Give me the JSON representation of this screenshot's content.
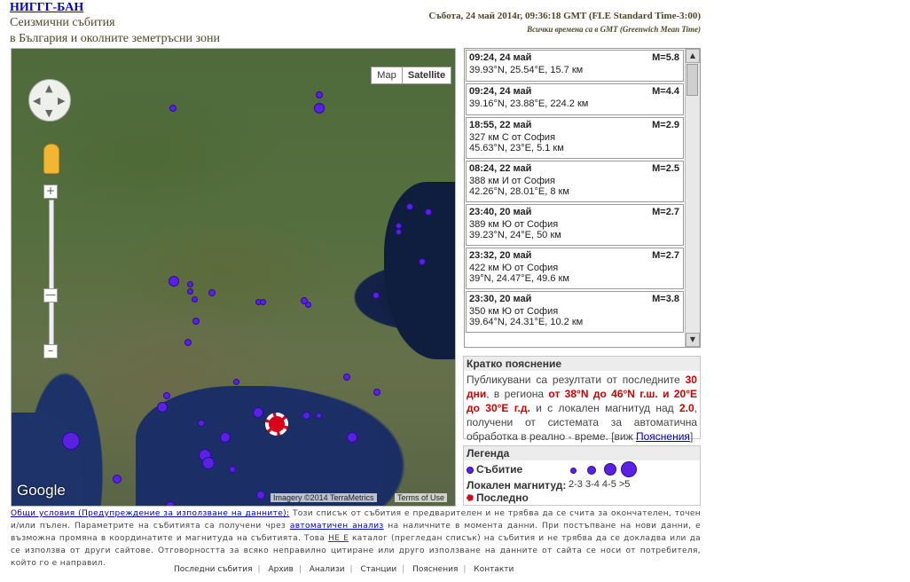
{
  "header": {
    "org_link": "НИГГГ-БАН",
    "subtitle_1": "Сеизмични събития",
    "subtitle_2": "в България и околните земетръсни зони",
    "datetime": "Събота, 24 май 2014г, 09:36:18 GMT (FLE Standard Time-3:00)",
    "gmt_note": "Всички времена са в GMT (Greenwich Mean Time)"
  },
  "map": {
    "map_button": "Map",
    "satellite_button": "Satellite",
    "zoom_in": "+",
    "zoom_out": "–",
    "google_logo": "Google",
    "imagery": "Imagery ©2014 TerraMetrics",
    "terms": "Terms of Use"
  },
  "events": [
    {
      "time": "09:24, 24 май",
      "mag": "M=5.8",
      "line1": "39.93°N, 25.54°E, 15.7 км",
      "line2": ""
    },
    {
      "time": "09:24, 24 май",
      "mag": "M=4.4",
      "line1": "39.16°N, 23.88°E, 224.2 км",
      "line2": ""
    },
    {
      "time": "18:55, 22 май",
      "mag": "M=2.9",
      "line1": "327 км С от София",
      "line2": "45.63°N, 23°E, 5.1 км"
    },
    {
      "time": "08:24, 22 май",
      "mag": "M=2.5",
      "line1": "388 км И от София",
      "line2": "42.26°N, 28.01°E, 8 км"
    },
    {
      "time": "23:40, 20 май",
      "mag": "M=2.7",
      "line1": "389 км Ю от София",
      "line2": "39.23°N, 24°E, 50 км"
    },
    {
      "time": "23:32, 20 май",
      "mag": "M=2.7",
      "line1": "422 км Ю от София",
      "line2": "39°N, 24.47°E, 49.6 км"
    },
    {
      "time": "23:30, 20 май",
      "mag": "M=3.8",
      "line1": "350 км Ю от София",
      "line2": "39.64°N, 24.31°E, 10.2 км"
    }
  ],
  "note": {
    "title": "Кратко пояснение",
    "p1": "Публикувани са резултати от последните",
    "p2": "30 дни",
    "p3": ", в региона",
    "p4": "от 38°N до 46°N г.ш. и 20°E до 30°E г.д.",
    "p5": "и с локален магнитуд над",
    "p6": "2.0",
    "p7": ", получени от системата за автоматична обработка в реално - време. [виж",
    "link": "Пояснения",
    "p8": "]"
  },
  "legend": {
    "title": "Легенда",
    "event_label": "Събитие",
    "mag_label": "Локален магнитуд:",
    "mag_ranges": "2-3 3-4 4-5 >5",
    "last_label": "Последно"
  },
  "disclaimer": {
    "terms_link": "Общи условия (Предупреждение за използване на данните):",
    "t1": "Този списък от събития е предварителен и не трябва да се счита за окончателен, точен и/или пълен. Параметрите на събитията са получени чрез",
    "auto_link": "автоматичен анализ",
    "t2": "на наличните в момента данни. При постъпване на нови данни, е възможна промяна в координатите и магнитуда на събитията. Това",
    "not": "НЕ Е",
    "t3": "каталог (прегледан списък) на събития и не трябва да се докладва или да се използва от други сайтове. Отговорността за всяко неправилно цитиране или друго използване на данните от сайта се носи от потребителя, който го е направил."
  },
  "footer_nav": [
    "Последни събития",
    "Архив",
    "Анализи",
    "Станции",
    "Пояснения",
    "Контакти"
  ],
  "colors": {
    "quake": "#5a22e0",
    "last": "#d9001b",
    "link": "#0000cc",
    "accent_red": "#cc0000"
  }
}
